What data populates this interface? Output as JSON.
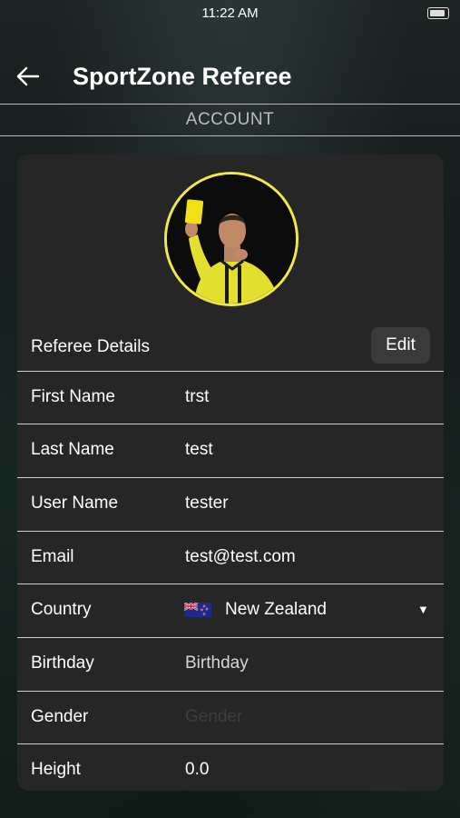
{
  "status_bar": {
    "time": "11:22 AM"
  },
  "header": {
    "title": "SportZone Referee"
  },
  "section": {
    "title": "ACCOUNT"
  },
  "profile": {
    "details_label": "Referee Details",
    "edit_label": "Edit",
    "fields": {
      "first_name": {
        "label": "First Name",
        "value": "trst"
      },
      "last_name": {
        "label": "Last Name",
        "value": "test"
      },
      "user_name": {
        "label": "User Name",
        "value": "tester"
      },
      "email": {
        "label": "Email",
        "value": "test@test.com"
      },
      "country": {
        "label": "Country",
        "value": "New Zealand",
        "flag": "new-zealand-flag-icon"
      },
      "birthday": {
        "label": "Birthday",
        "placeholder": "Birthday"
      },
      "gender": {
        "label": "Gender",
        "placeholder": "Gender"
      },
      "height": {
        "label": "Height",
        "value": "0.0"
      }
    }
  },
  "colors": {
    "avatar_ring": "#f1e94a",
    "card_bg": "#262626",
    "divider": "#cfcfcf"
  }
}
